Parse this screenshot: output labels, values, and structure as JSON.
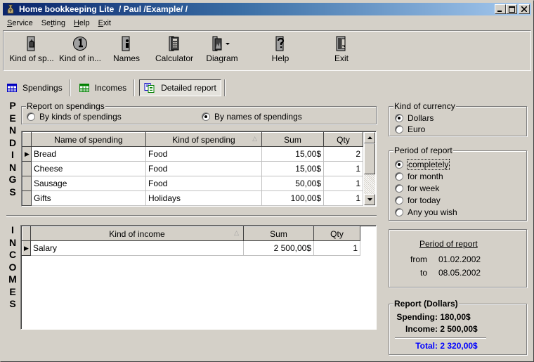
{
  "window": {
    "title": "Home bookkeeping Lite  / Paul /Example/ /",
    "controls": {
      "minimize": "_",
      "maximize": "□",
      "close": "×"
    }
  },
  "menu": [
    {
      "label": "Service",
      "accel": "S"
    },
    {
      "label": "Setting",
      "accel": "t"
    },
    {
      "label": "Help",
      "accel": "H"
    },
    {
      "label": "Exit",
      "accel": "E"
    }
  ],
  "toolbar": [
    {
      "label": "Kind of sp...",
      "icon": "kind-of-spendings-icon"
    },
    {
      "label": "Kind of in...",
      "icon": "kind-of-incomes-icon"
    },
    {
      "label": "Names",
      "icon": "names-icon"
    },
    {
      "label": "Calculator",
      "icon": "calculator-icon"
    },
    {
      "label": "Diagram",
      "icon": "diagram-icon"
    },
    {
      "label": "Help",
      "icon": "help-icon"
    },
    {
      "label": "Exit",
      "icon": "exit-icon"
    }
  ],
  "tabs": [
    {
      "label": "Spendings",
      "icon": "table-icon",
      "active": false
    },
    {
      "label": "Incomes",
      "icon": "table-icon",
      "active": false
    },
    {
      "label": "Detailed report",
      "icon": "report-icon",
      "active": true
    }
  ],
  "spendings": {
    "vertical_label": [
      "P",
      "E",
      "N",
      "D",
      "I",
      "N",
      "G",
      "S"
    ],
    "report_group": {
      "legend": "Report on spendings",
      "options": [
        {
          "label": "By kinds of spendings",
          "checked": false
        },
        {
          "label": "By names of spendings",
          "checked": true
        }
      ]
    },
    "columns": [
      "Name of spending",
      "Kind of spending",
      "Sum",
      "Qty"
    ],
    "sorted_column": "Kind of spending",
    "rows": [
      {
        "name": "Bread",
        "kind": "Food",
        "sum": "15,00$",
        "qty": "2",
        "current": true
      },
      {
        "name": "Cheese",
        "kind": "Food",
        "sum": "15,00$",
        "qty": "1",
        "current": false
      },
      {
        "name": "Sausage",
        "kind": "Food",
        "sum": "50,00$",
        "qty": "1",
        "current": false
      },
      {
        "name": "Gifts",
        "kind": "Holidays",
        "sum": "100,00$",
        "qty": "1",
        "current": false
      }
    ]
  },
  "incomes": {
    "vertical_label": [
      "I",
      "N",
      "C",
      "O",
      "M",
      "E",
      "S"
    ],
    "columns": [
      "Kind of income",
      "Sum",
      "Qty"
    ],
    "sorted_column": "Kind of income",
    "rows": [
      {
        "kind": "Salary",
        "sum": "2 500,00$",
        "qty": "1",
        "current": true
      }
    ]
  },
  "currency": {
    "legend": "Kind of currency",
    "options": [
      {
        "label": "Dollars",
        "checked": true
      },
      {
        "label": "Euro",
        "checked": false
      }
    ]
  },
  "period": {
    "legend": "Period of report",
    "options": [
      {
        "label": "completely",
        "checked": true
      },
      {
        "label": "for month",
        "checked": false
      },
      {
        "label": "for week",
        "checked": false
      },
      {
        "label": "for today",
        "checked": false
      },
      {
        "label": "Any you wish",
        "checked": false
      }
    ]
  },
  "period_info": {
    "title": "Period of report",
    "from_label": "from",
    "from": "01.02.2002",
    "to_label": "to",
    "to": "08.05.2002"
  },
  "report": {
    "legend": "Report (Dollars)",
    "spending_label": "Spending:",
    "spending": "180,00$",
    "income_label": "Income:",
    "income": "2 500,00$",
    "total_label": "Total:",
    "total": "2 320,00$",
    "total_color": "#0000ff"
  }
}
